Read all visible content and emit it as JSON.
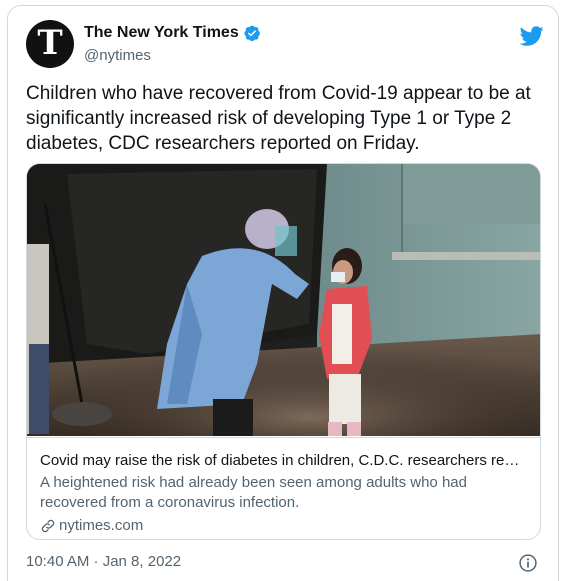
{
  "author": {
    "display_name": "The New York Times",
    "handle": "@nytimes",
    "avatar_letter": "T",
    "verified": true
  },
  "tweet": {
    "text": "Children who have recovered from Covid-19 appear to be at significantly increased risk of developing Type 1 or Type 2 diabetes, CDC researchers reported on Friday."
  },
  "link_card": {
    "title": "Covid may raise the risk of diabetes in children, C.D.C. researchers re…",
    "description": "A heightened risk had already been seen among adults who had recovered from a coronavirus infection.",
    "domain": "nytimes.com",
    "image_icon": "photo-health-worker-swabbing-child"
  },
  "meta": {
    "timestamp": "10:40 AM · Jan 8, 2022"
  },
  "icons": {
    "brand": "twitter-bird-icon",
    "verified": "verified-badge-icon",
    "link": "link-icon",
    "info": "info-icon"
  },
  "colors": {
    "brand_blue": "#1d9bf0",
    "text_primary": "#0f1419",
    "text_secondary": "#536471",
    "border": "#cfd9de"
  }
}
